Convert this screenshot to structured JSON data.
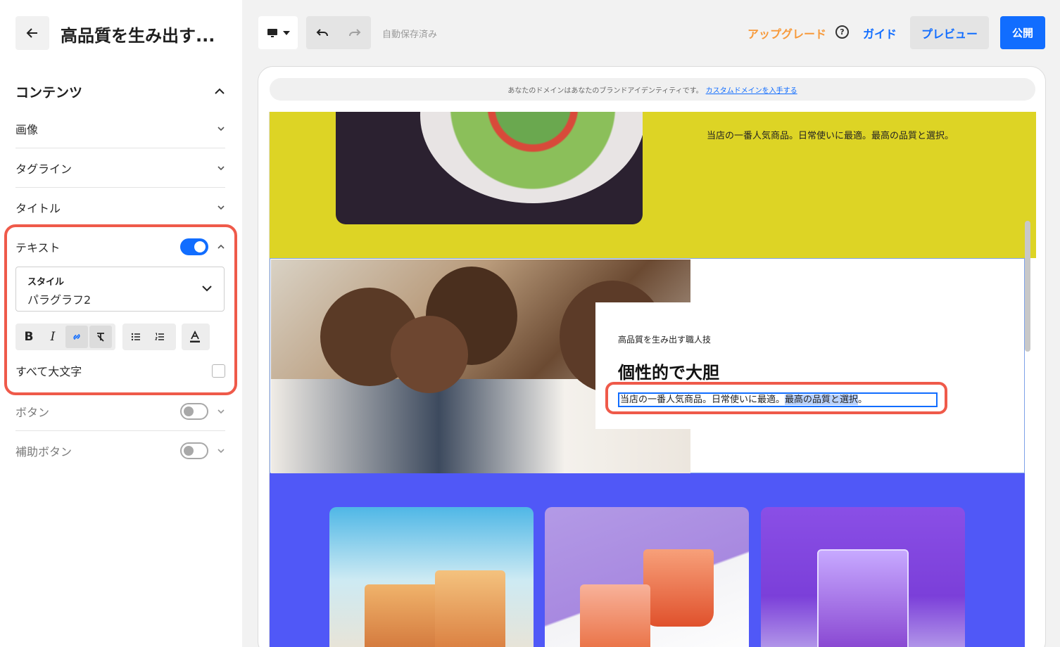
{
  "sidebar": {
    "title": "高品質を生み出す...",
    "content_section": "コンテンツ",
    "items": [
      {
        "label": "画像"
      },
      {
        "label": "タグライン"
      },
      {
        "label": "タイトル"
      }
    ],
    "text_item": {
      "label": "テキスト",
      "enabled": true,
      "style_caption": "スタイル",
      "style_value": "パラグラフ2",
      "all_caps_label": "すべて大文字"
    },
    "button_item": {
      "label": "ボタン",
      "enabled": false
    },
    "secondary_button_item": {
      "label": "補助ボタン",
      "enabled": false
    }
  },
  "toolbar": {
    "autosave": "自動保存済み",
    "upgrade": "アップグレード",
    "guide": "ガイド",
    "preview": "プレビュー",
    "publish": "公開",
    "help_glyph": "?"
  },
  "canvas": {
    "domain_notice": "あなたのドメインはあなたのブランドアイデンティティです。",
    "domain_link": "カスタムドメインを入手する",
    "yellow_section_text": "当店の一番人気商品。日常使いに最適。最高の品質と選択。",
    "card": {
      "tagline": "高品質を生み出す職人技",
      "title": "個性的で大胆",
      "paragraph_plain": "当店の一番人気商品。日常使いに最適。",
      "paragraph_selected": "最高の品質と選択",
      "paragraph_end": "。"
    }
  },
  "colors": {
    "accent": "#116dff",
    "upgrade": "#f79a3b",
    "highlight": "#ef5a4a",
    "yellow_section": "#ddd425",
    "blue_section": "#5058f7"
  }
}
